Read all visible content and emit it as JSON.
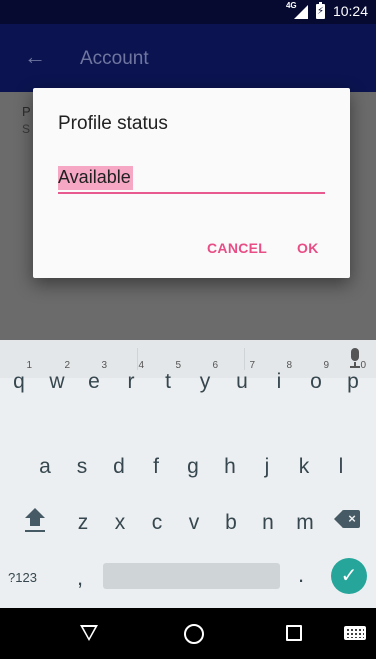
{
  "status_bar": {
    "network_label": "4G",
    "time": "10:24",
    "icons": [
      "signal-icon",
      "battery-charging-icon"
    ]
  },
  "app_bar": {
    "back_icon": "arrow-back-icon",
    "title": "Account"
  },
  "background_row": {
    "title_fragment": "P",
    "subtitle_fragment": "S"
  },
  "dialog": {
    "title": "Profile status",
    "field_value": "Available",
    "cancel_label": "CANCEL",
    "ok_label": "OK",
    "accent_color": "#e84d86"
  },
  "keyboard": {
    "mic_icon": "mic-icon",
    "row1": [
      {
        "key": "q",
        "hint": "1"
      },
      {
        "key": "w",
        "hint": "2"
      },
      {
        "key": "e",
        "hint": "3"
      },
      {
        "key": "r",
        "hint": "4"
      },
      {
        "key": "t",
        "hint": "5"
      },
      {
        "key": "y",
        "hint": "6"
      },
      {
        "key": "u",
        "hint": "7"
      },
      {
        "key": "i",
        "hint": "8"
      },
      {
        "key": "o",
        "hint": "9"
      },
      {
        "key": "p",
        "hint": "0"
      }
    ],
    "row2": [
      "a",
      "s",
      "d",
      "f",
      "g",
      "h",
      "j",
      "k",
      "l"
    ],
    "row3": [
      "z",
      "x",
      "c",
      "v",
      "b",
      "n",
      "m"
    ],
    "symbols_label": "?123",
    "comma": ",",
    "period": ".",
    "shift_icon": "shift-icon",
    "backspace_icon": "backspace-icon",
    "enter_icon": "checkmark-icon",
    "enter_glyph": "✓",
    "enter_color": "#26a69a"
  },
  "nav_bar": {
    "icons": [
      "nav-back-icon",
      "nav-home-icon",
      "nav-recents-icon",
      "keyboard-switch-icon"
    ]
  }
}
